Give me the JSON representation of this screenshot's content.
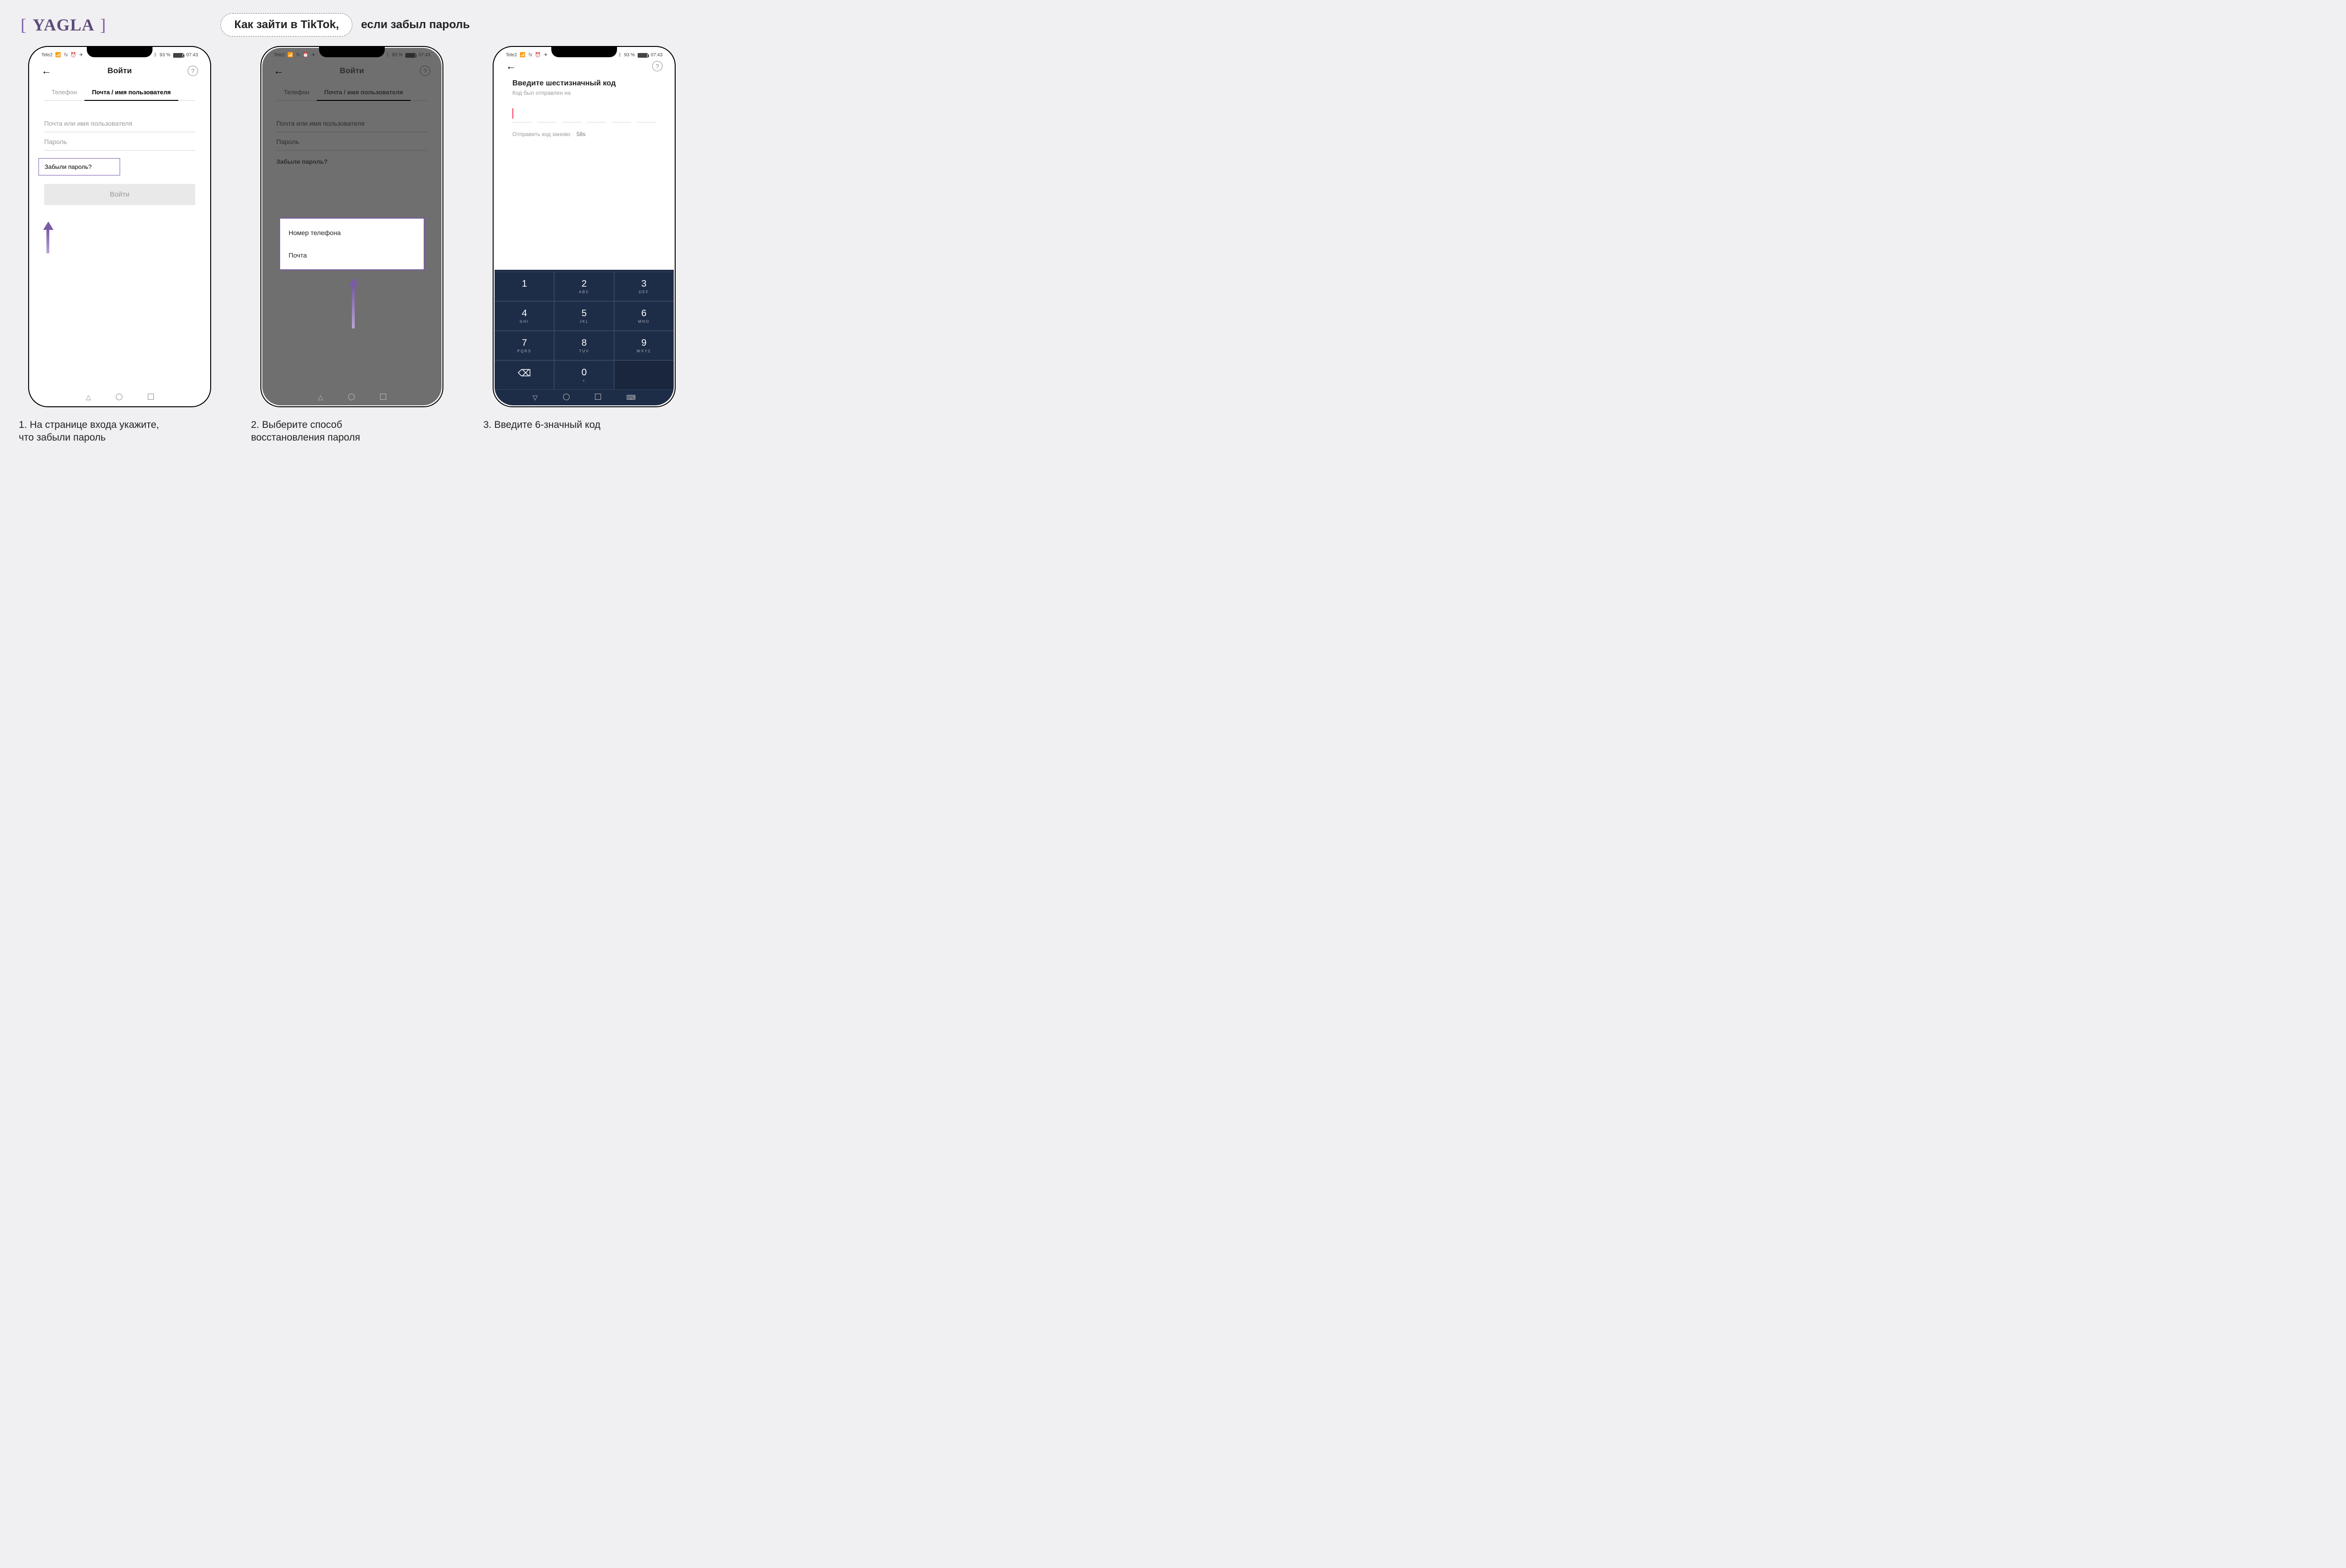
{
  "accent_color": "#7b5aa6",
  "logo_text": "YAGLA",
  "title_pill": "Как зайти в TikTok,",
  "title_tail": "если забыл пароль",
  "statusbar": {
    "carrier": "Tele2",
    "icons_desc": "4G · сигнал · NFC · часы · телеграм",
    "bt_text": "93 %",
    "time": "07:43"
  },
  "login_screen": {
    "header_title": "Войти",
    "tab_phone": "Телефон",
    "tab_email": "Почта / имя пользователя",
    "field_email": "Почта или имя пользователя",
    "field_password": "Пароль",
    "forgot": "Забыли пароль?",
    "submit": "Войти"
  },
  "popup": {
    "option_phone": "Номер телефона",
    "option_email": "Почта"
  },
  "code_screen": {
    "title": "Введите шестизначный код",
    "subtitle": "Код был отправлен на",
    "resend_label": "Отправить код заново",
    "resend_seconds": "58s"
  },
  "keypad": [
    [
      "1",
      ""
    ],
    [
      "2",
      "ABC"
    ],
    [
      "3",
      "DEF"
    ],
    [
      "4",
      "GHI"
    ],
    [
      "5",
      "JKL"
    ],
    [
      "6",
      "MNO"
    ],
    [
      "7",
      "PQRS"
    ],
    [
      "8",
      "TUV"
    ],
    [
      "9",
      "WXYZ"
    ],
    [
      "⌫",
      ""
    ],
    [
      "0",
      "+"
    ],
    [
      "",
      ""
    ]
  ],
  "captions": {
    "c1": "1. На странице входа укажите,\n     что забыли пароль",
    "c2": "2. Выберите способ\n     восстановления пароля",
    "c3": "3. Введите 6-значный код"
  }
}
